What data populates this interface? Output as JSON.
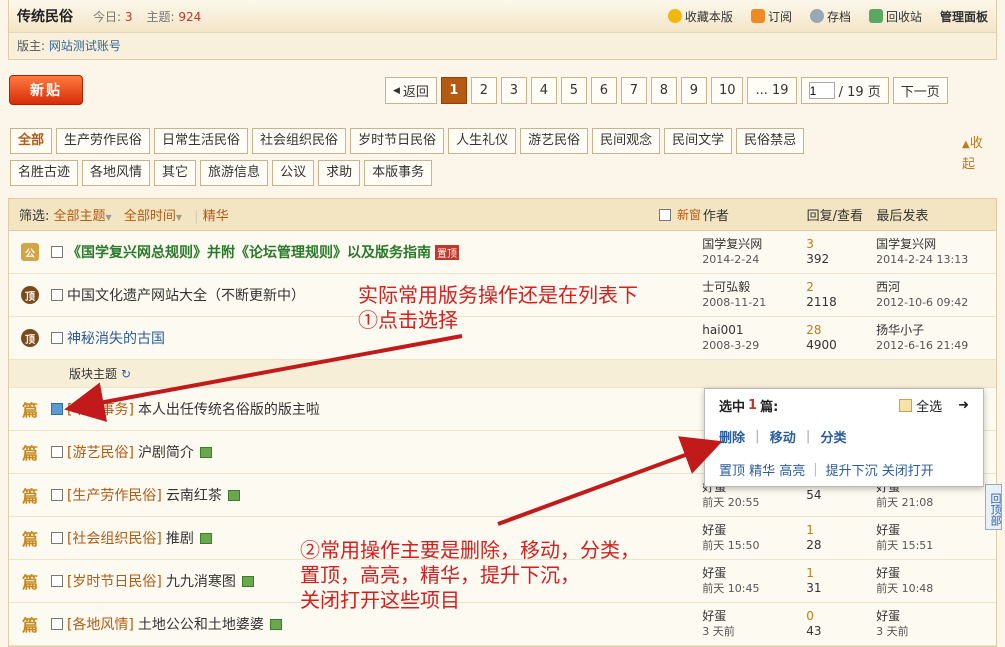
{
  "header": {
    "title": "传统民俗",
    "today_label": "今日:",
    "today_value": "3",
    "topics_label": "主题:",
    "topics_value": "924",
    "actions": [
      "收藏本版",
      "订阅",
      "存档",
      "回收站",
      "管理面板"
    ],
    "moderator_label": "版主:",
    "moderator_name": "网站测试账号"
  },
  "new_post_button": "新贴",
  "pager": {
    "back": "返回",
    "pages": [
      "1",
      "2",
      "3",
      "4",
      "5",
      "6",
      "7",
      "8",
      "9",
      "10",
      "... 19"
    ],
    "current_input": "1",
    "total": "/ 19 页",
    "next": "下一页"
  },
  "categories": [
    "全部",
    "生产劳作民俗",
    "日常生活民俗",
    "社会组织民俗",
    "岁时节日民俗",
    "人生礼仪",
    "游艺民俗",
    "民间观念",
    "民间文学",
    "民俗禁忌",
    "名胜古迹",
    "各地风情",
    "其它",
    "旅游信息",
    "公议",
    "求助",
    "本版事务"
  ],
  "collapse_label": "收起",
  "table_header": {
    "filter_label": "筛选:",
    "all_topics": "全部主题",
    "all_time": "全部时间",
    "digest": "精华",
    "new_window": "新窗",
    "author": "作者",
    "replies": "回复/查看",
    "last_post": "最后发表"
  },
  "threads_top": [
    {
      "icon": "announcement-icon",
      "title": "《国学复兴网总规则》并附《论坛管理规则》以及版务指南",
      "badge": "置顶",
      "author": "国学复兴网",
      "date": "2014-2-24",
      "replies": "3",
      "views": "392",
      "last_user": "国学复兴网",
      "last_time": "2014-2-24 13:13"
    },
    {
      "icon": "sticky-icon",
      "title": "中国文化遗产网站大全（不断更新中）",
      "author": "士可弘毅",
      "date": "2008-11-21",
      "replies": "2",
      "views": "2118",
      "last_user": "西河",
      "last_time": "2012-10-6 09:42"
    },
    {
      "icon": "sticky-icon",
      "title": "神秘消失的古国",
      "author": "hai001",
      "date": "2008-3-29",
      "replies": "28",
      "views": "4900",
      "last_user": "扬华小子",
      "last_time": "2012-6-16 21:49"
    }
  ],
  "section_label": "版块主题",
  "threads": [
    {
      "tag": "[本版事务]",
      "title": "本人出任传统名俗版的版主啦",
      "checked": true,
      "author": "",
      "date": "",
      "replies": "",
      "views": "",
      "last_user": "",
      "last_time": ""
    },
    {
      "tag": "[游艺民俗]",
      "title": "沪剧简介",
      "checked": false,
      "author": "",
      "date": "",
      "replies": "",
      "views": "",
      "last_user": "",
      "last_time": ""
    },
    {
      "tag": "[生产劳作民俗]",
      "title": "云南红茶",
      "checked": false,
      "author": "好蛋",
      "date": "前天 20:55",
      "replies": "",
      "views": "54",
      "last_user": "好蛋",
      "last_time": "前天 21:08"
    },
    {
      "tag": "[社会组织民俗]",
      "title": "推剧",
      "checked": false,
      "author": "好蛋",
      "date": "前天 15:50",
      "replies": "1",
      "views": "28",
      "last_user": "好蛋",
      "last_time": "前天 15:51"
    },
    {
      "tag": "[岁时节日民俗]",
      "title": "九九消寒图",
      "checked": false,
      "author": "好蛋",
      "date": "前天 10:45",
      "replies": "1",
      "views": "31",
      "last_user": "好蛋",
      "last_time": "前天 10:48"
    },
    {
      "tag": "[各地风情]",
      "title": "土地公公和土地婆婆",
      "checked": false,
      "author": "好蛋",
      "date": "3 天前",
      "replies": "0",
      "views": "43",
      "last_user": "好蛋",
      "last_time": "3 天前"
    }
  ],
  "mod_popup": {
    "selected_prefix": "选中",
    "selected_count": "1",
    "selected_suffix": "篇:",
    "select_all": "全选",
    "row1": [
      "删除",
      "移动",
      "分类"
    ],
    "row2a": "置顶 精华 高亮",
    "row2b": "提升下沉 关闭打开"
  },
  "annotations": {
    "note1_line1": "实际常用版务操作还是在列表下",
    "note1_line2": "①点击选择",
    "note2_line1": "②常用操作主要是删除，移动，分类，",
    "note2_line2": "置顶，高亮，精华，提升下沉，",
    "note2_line3": "关闭打开这些项目"
  },
  "back_to_top": "回顶部"
}
